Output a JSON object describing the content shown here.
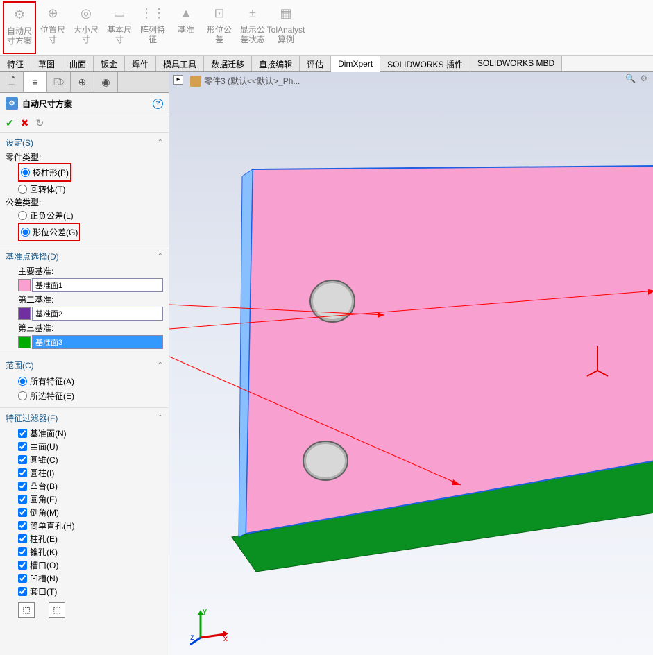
{
  "ribbon": {
    "items": [
      {
        "label": "自动尺寸方案",
        "icon": "⚙"
      },
      {
        "label": "位置尺寸",
        "icon": "⊕"
      },
      {
        "label": "大小尺寸",
        "icon": "◎"
      },
      {
        "label": "基本尺寸",
        "icon": "▭"
      },
      {
        "label": "阵列特征",
        "icon": "⋮⋮"
      },
      {
        "label": "基准",
        "icon": "▲"
      },
      {
        "label": "形位公差",
        "icon": "⊡"
      },
      {
        "label": "显示公差状态",
        "icon": "±"
      },
      {
        "label": "TolAnalyst 算例",
        "icon": "▦"
      }
    ]
  },
  "tabs": [
    "特征",
    "草图",
    "曲面",
    "钣金",
    "焊件",
    "模具工具",
    "数据迁移",
    "直接编辑",
    "评估",
    "DimXpert",
    "SOLIDWORKS 插件",
    "SOLIDWORKS MBD"
  ],
  "active_tab": "DimXpert",
  "breadcrumb": "零件3 (默认<<默认>_Ph...",
  "panel": {
    "title": "自动尺寸方案",
    "settings": {
      "header": "设定(S)",
      "part_type_label": "零件类型:",
      "part_type": {
        "prismatic": "棱柱形(P)",
        "turned": "回转体(T)"
      },
      "tol_type_label": "公差类型:",
      "tol_type": {
        "plus_minus": "正负公差(L)",
        "geometric": "形位公差(G)"
      }
    },
    "datum": {
      "header": "基准点选择(D)",
      "primary_label": "主要基准:",
      "primary_value": "基准面1",
      "secondary_label": "第二基准:",
      "secondary_value": "基准面2",
      "tertiary_label": "第三基准:",
      "tertiary_value": "基准面3"
    },
    "scope": {
      "header": "范围(C)",
      "all": "所有特征(A)",
      "selected": "所选特征(E)"
    },
    "filter": {
      "header": "特征过滤器(F)",
      "items": [
        "基准面(N)",
        "曲面(U)",
        "圆锥(C)",
        "圆柱(I)",
        "凸台(B)",
        "圆角(F)",
        "倒角(M)",
        "简单直孔(H)",
        "柱孔(E)",
        "锥孔(K)",
        "槽口(O)",
        "凹槽(N)",
        "套口(T)"
      ]
    }
  }
}
